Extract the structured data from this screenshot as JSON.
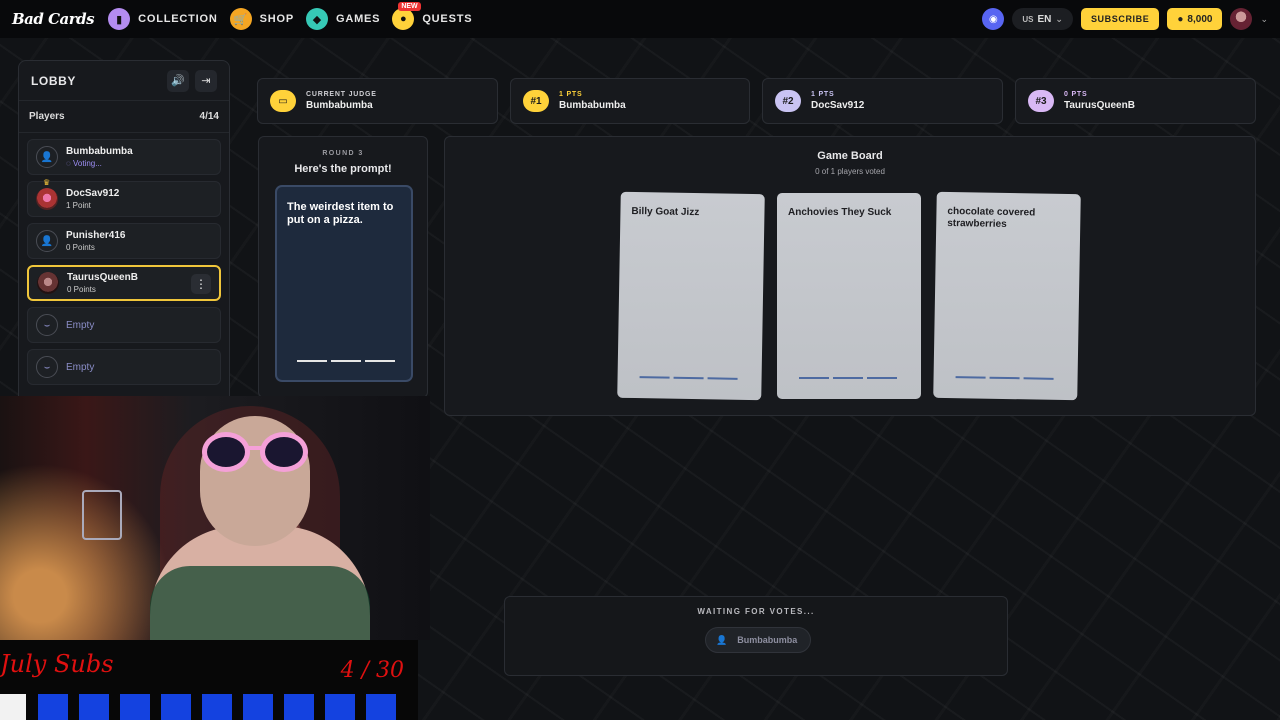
{
  "nav": {
    "logo": "Bad Cards",
    "items": [
      {
        "label": "COLLECTION",
        "icon": "card-icon",
        "color": "#b48cf0"
      },
      {
        "label": "SHOP",
        "icon": "cart-icon",
        "color": "#f5a623"
      },
      {
        "label": "GAMES",
        "icon": "game-icon",
        "color": "#36c9b6"
      },
      {
        "label": "QUESTS",
        "icon": "quest-icon",
        "color": "#ffd23a",
        "badge": "NEW"
      }
    ],
    "region": "US",
    "lang": "EN",
    "subscribe": "SUBSCRIBE",
    "coins": "8,000"
  },
  "lobby": {
    "title": "LOBBY",
    "players_label": "Players",
    "players_count": "4/14",
    "players": [
      {
        "name": "Bumbabumba",
        "sub": "Voting..."
      },
      {
        "name": "DocSav912",
        "sub": "1 Point"
      },
      {
        "name": "Punisher416",
        "sub": "0 Points"
      },
      {
        "name": "TaurusQueenB",
        "sub": "0 Points"
      }
    ],
    "empty": [
      "Empty",
      "Empty"
    ]
  },
  "stats": {
    "judge": {
      "top": "CURRENT JUDGE",
      "name": "Bumbabumba"
    },
    "rank1": {
      "badge": "#1",
      "top": "1 PTS",
      "name": "Bumbabumba",
      "color": "#ffd23a"
    },
    "rank2": {
      "badge": "#2",
      "top": "1 PTS",
      "name": "DocSav912",
      "color": "#c9c3f2"
    },
    "rank3": {
      "badge": "#3",
      "top": "0 PTS",
      "name": "TaurusQueenB",
      "color": "#d9b8f5"
    }
  },
  "prompt": {
    "round": "ROUND 3",
    "heading": "Here's the prompt!",
    "text": "The weirdest item to put on a pizza."
  },
  "board": {
    "title": "Game Board",
    "subtitle": "0 of 1 players voted",
    "answers": [
      "Billy Goat Jizz",
      "Anchovies They Suck",
      "chocolate covered strawberries"
    ]
  },
  "waiting": {
    "title": "WAITING FOR VOTES...",
    "player": "Bumbabumba"
  },
  "overlay": {
    "subs_title": "July Subs",
    "subs_count": "4 / 30"
  }
}
